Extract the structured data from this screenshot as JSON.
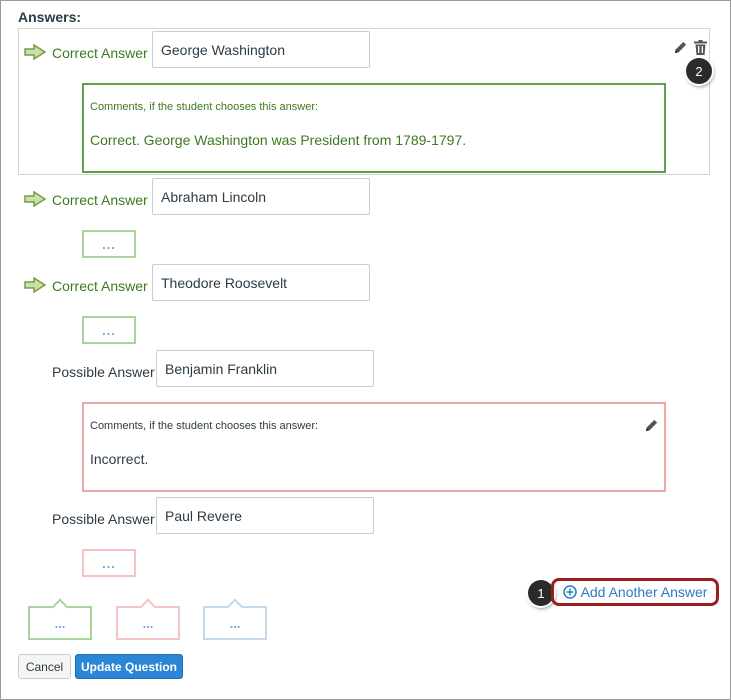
{
  "section_title": "Answers:",
  "answers": [
    {
      "type_label": "Correct Answer",
      "value": "George Washington"
    },
    {
      "type_label": "Correct Answer",
      "value": "Abraham Lincoln"
    },
    {
      "type_label": "Correct Answer",
      "value": "Theodore Roosevelt"
    },
    {
      "type_label": "Possible Answer",
      "value": "Benjamin Franklin"
    },
    {
      "type_label": "Possible Answer",
      "value": "Paul Revere"
    }
  ],
  "comments": {
    "label": "Comments, if the student chooses this answer:",
    "washington": "Correct. George Washington was President from 1789-1797.",
    "franklin": "Incorrect."
  },
  "ellipsis": "...",
  "add_answer_label": "Add Another Answer",
  "badges": {
    "one": "1",
    "two": "2"
  },
  "buttons": {
    "cancel": "Cancel",
    "update": "Update Question"
  },
  "colors": {
    "correct": "#3c7a20",
    "link": "#2a7bc0",
    "primary": "#2b87d6",
    "highlight": "#9b1d20"
  }
}
